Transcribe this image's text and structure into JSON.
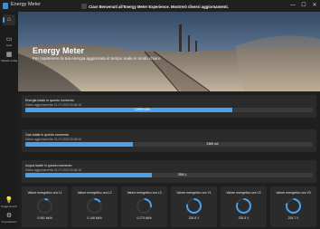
{
  "window": {
    "title": "Energy Meter",
    "banner_text": "Ciao! Benvenuti all'Energy Meter Experience. Mostrerò diversi aggiornamenti.",
    "controls": {
      "minimize": "—",
      "maximize": "☐",
      "close": "✕"
    }
  },
  "sidebar": {
    "items": [
      {
        "label": "",
        "icon": "home-icon",
        "glyph": "⌂",
        "selected": true
      },
      {
        "label": "Casi",
        "icon": "cases-icon",
        "glyph": "▭"
      },
      {
        "label": "Tabella di dati",
        "icon": "table-icon",
        "glyph": "▦"
      }
    ],
    "bottom": [
      {
        "label": "Suggerimenti",
        "icon": "lightbulb-icon",
        "glyph": "💡"
      },
      {
        "label": "Impostazioni",
        "icon": "gear-icon",
        "glyph": "⚙"
      }
    ]
  },
  "hero": {
    "title": "Energy Meter",
    "subtitle": "Per mantenere la tua energia aggiornata in tempo reale in modo chiaro"
  },
  "cards": [
    {
      "title": "Energia totale in questo momento",
      "updated": "Ultimo aggiornamento 01-07-2023 09:48:16",
      "value": "12825 kWh",
      "fill": 0.72,
      "value_pos": 0.38
    },
    {
      "title": "Gas totale in questo momento",
      "updated": "Ultimo aggiornamento 01-07-2023 09:48:16",
      "value": "2365 m3",
      "fill": 0.375,
      "value_pos": 0.63
    },
    {
      "title": "Acqua totale in questo momento",
      "updated": "Ultimo aggiornamento 01-07-2023 09:48:16",
      "value": "7850 L",
      "fill": 0.44,
      "value_pos": 0.53
    }
  ],
  "gauges": [
    {
      "title": "Valore energetico ora L1",
      "value": "0.061 kWh",
      "level": 0.08
    },
    {
      "title": "Valore energetico ora L2",
      "value": "0.146 kWh",
      "level": 0.15
    },
    {
      "title": "Valore energetico ora L3",
      "value": "0.273 kWh",
      "level": 0.28
    },
    {
      "title": "Valore energetico ora V1",
      "value": "226.8 V",
      "level": 0.78
    },
    {
      "title": "Valore energetico ora V2",
      "value": "235.5 V",
      "level": 0.82
    },
    {
      "title": "Valore energetico ora V3",
      "value": "234.7 V",
      "level": 0.81
    }
  ],
  "colors": {
    "accent": "#4aa2ec",
    "track": "#3a3a3a",
    "card": "#2b2b2b",
    "background": "#1f1f1f"
  }
}
